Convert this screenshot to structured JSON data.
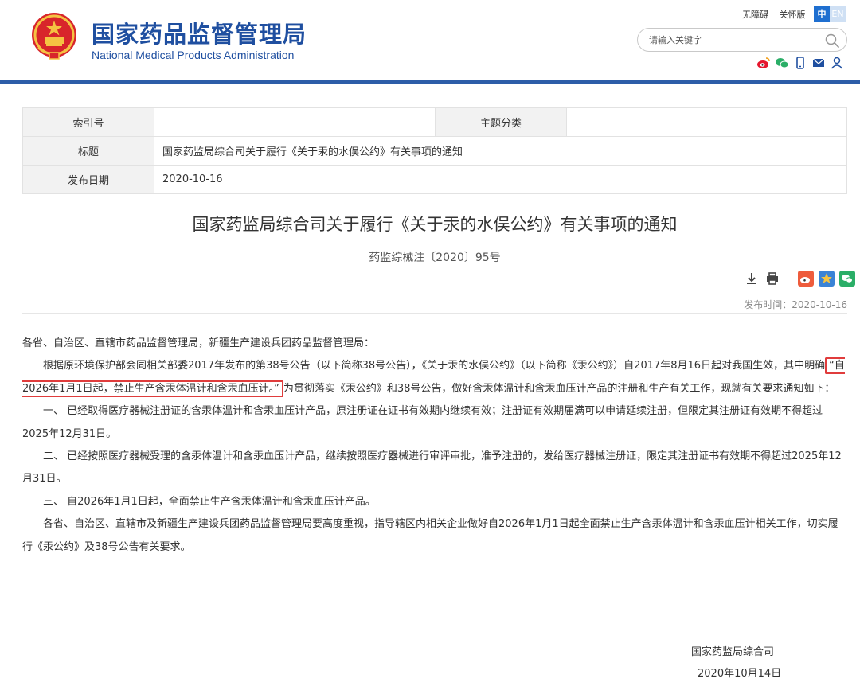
{
  "header": {
    "site_name_cn": "国家药品监督管理局",
    "site_name_en": "National Medical Products Administration",
    "links": [
      "无障碍",
      "关怀版"
    ],
    "lang_cn": "中",
    "lang_en": "EN",
    "search_placeholder": "请输入关键字",
    "social_icons": [
      "weibo-icon",
      "wechat-icon",
      "mobile-icon",
      "mail-icon",
      "user-icon"
    ]
  },
  "info_table": {
    "index_label": "索引号",
    "index_value": "",
    "category_label": "主题分类",
    "category_value": "",
    "title_label": "标题",
    "title_value": "国家药监局综合司关于履行《关于汞的水俣公约》有关事项的通知",
    "date_label": "发布日期",
    "date_value": "2020-10-16"
  },
  "article": {
    "title": "国家药监局综合司关于履行《关于汞的水俣公约》有关事项的通知",
    "doc_number": "药监综械注〔2020〕95号",
    "publish_time": "发布时间：2020-10-16",
    "greeting": "各省、自治区、直辖市药品监督管理局，新疆生产建设兵团药品监督管理局：",
    "para1_before": "根据原环境保护部会同相关部委2017年发布的第38号公告（以下简称38号公告），《关于汞的水俣公约》（以下简称《汞公约》）自2017年8月16日起对我国生效，其中明确",
    "para1_highlight": "“自2026年1月1日起，禁止生产含汞体温计和含汞血压计。”",
    "para1_after": "为贯彻落实《汞公约》和38号公告，做好含汞体温计和含汞血压计产品的注册和生产有关工作，现就有关要求通知如下：",
    "item1": "一、 已经取得医疗器械注册证的含汞体温计和含汞血压计产品，原注册证在证书有效期内继续有效；注册证有效期届满可以申请延续注册，但限定其注册证有效期不得超过2025年12月31日。",
    "item2": "二、 已经按照医疗器械受理的含汞体温计和含汞血压计产品，继续按照医疗器械进行审评审批，准予注册的，发给医疗器械注册证，限定其注册证书有效期不得超过2025年12月31日。",
    "item3": "三、 自2026年1月1日起，全面禁止生产含汞体温计和含汞血压计产品。",
    "closing": "各省、自治区、直辖市及新疆生产建设兵团药品监督管理局要高度重视，指导辖区内相关企业做好自2026年1月1日起全面禁止生产含汞体温计和含汞血压计相关工作，切实履行《汞公约》及38号公告有关要求。",
    "signature_org": "国家药监局综合司",
    "signature_date": "2020年10月14日"
  },
  "colors": {
    "brand_blue": "#1f4fa0",
    "header_bar": "#2d5da8",
    "highlight_red": "#e03c3c"
  }
}
